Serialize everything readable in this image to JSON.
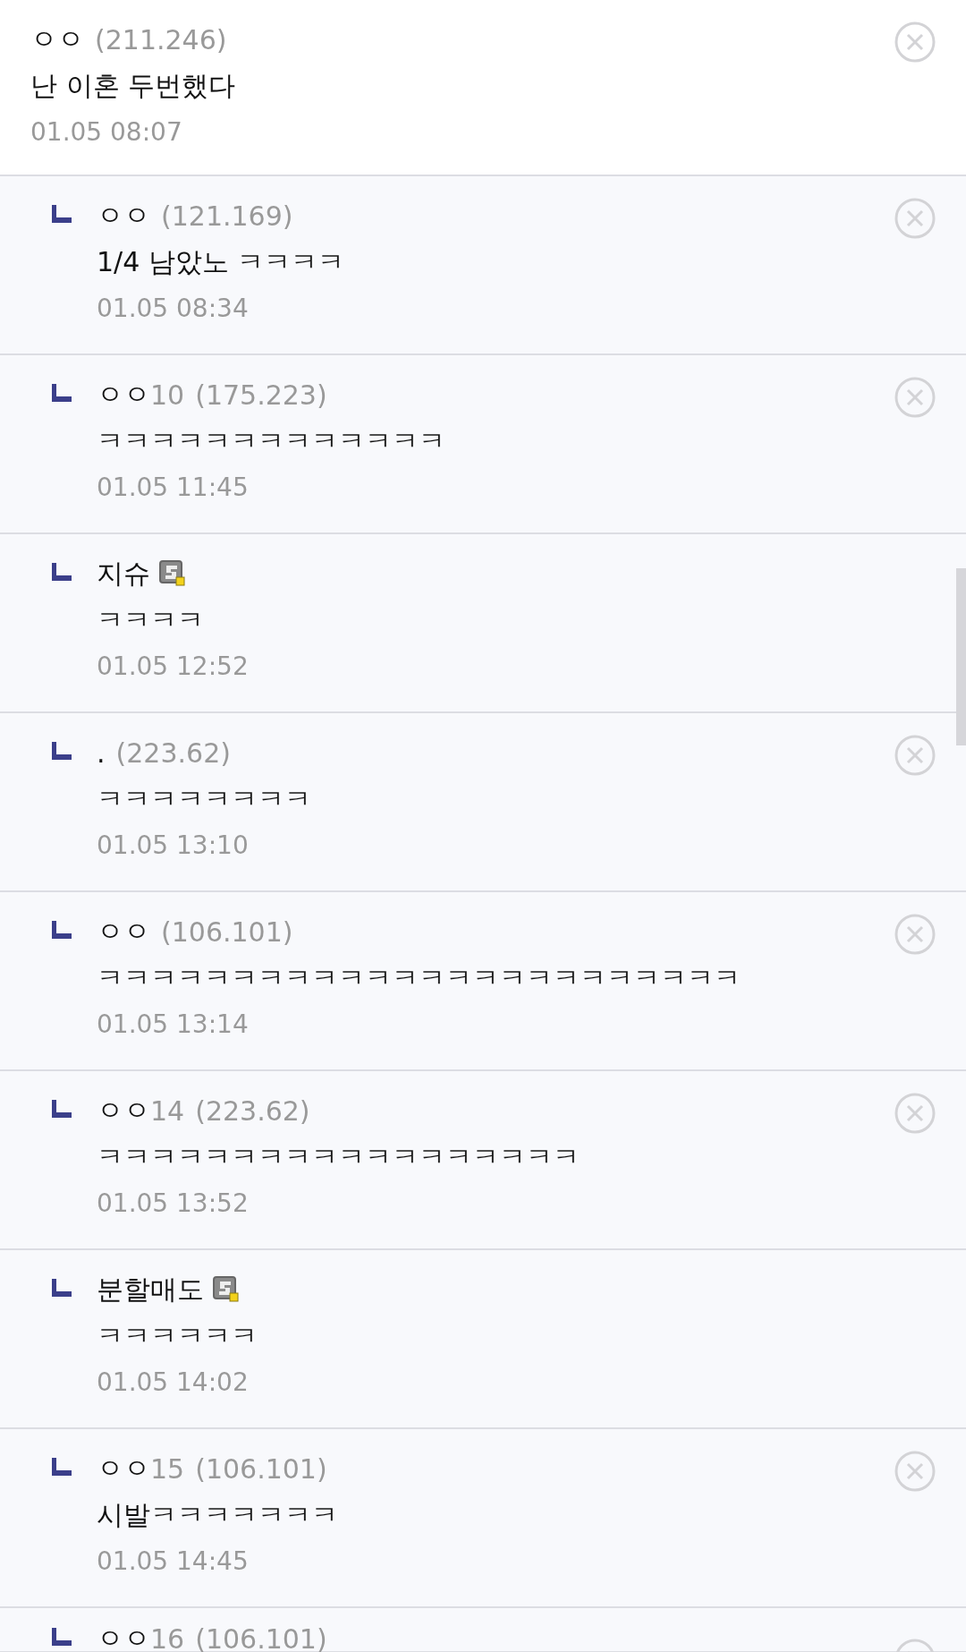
{
  "comments": [
    {
      "kind": "comment",
      "name": "ㅇㅇ",
      "ip": "(211.246)",
      "member": false,
      "deletable": true,
      "text": "난 이혼 두번했다",
      "time": "01.05 08:07"
    },
    {
      "kind": "reply",
      "name": "ㅇㅇ",
      "ip": "(121.169)",
      "member": false,
      "deletable": true,
      "text": "1/4 남았노 ㅋㅋㅋㅋ",
      "time": "01.05 08:34"
    },
    {
      "kind": "reply",
      "name": "ㅇㅇ",
      "tag": "10",
      "ip": "(175.223)",
      "member": false,
      "deletable": true,
      "text": "ㅋㅋㅋㅋㅋㅋㅋㅋㅋㅋㅋㅋㅋ",
      "time": "01.05 11:45"
    },
    {
      "kind": "reply",
      "name": "지슈",
      "member": true,
      "deletable": false,
      "text": "ㅋㅋㅋㅋ",
      "time": "01.05 12:52"
    },
    {
      "kind": "reply",
      "name": ".",
      "ip": "(223.62)",
      "member": false,
      "deletable": true,
      "text": "ㅋㅋㅋㅋㅋㅋㅋㅋ",
      "time": "01.05 13:10"
    },
    {
      "kind": "reply",
      "name": "ㅇㅇ",
      "ip": "(106.101)",
      "member": false,
      "deletable": true,
      "text": "ㅋㅋㅋㅋㅋㅋㅋㅋㅋㅋㅋㅋㅋㅋㅋㅋㅋㅋㅋㅋㅋㅋㅋㅋ",
      "time": "01.05 13:14"
    },
    {
      "kind": "reply",
      "name": "ㅇㅇ",
      "tag": "14",
      "ip": "(223.62)",
      "member": false,
      "deletable": true,
      "text": "ㅋㅋㅋㅋㅋㅋㅋㅋㅋㅋㅋㅋㅋㅋㅋㅋㅋㅋ",
      "time": "01.05 13:52"
    },
    {
      "kind": "reply",
      "name": "분할매도",
      "member": true,
      "deletable": false,
      "text": "ㅋㅋㅋㅋㅋㅋ",
      "time": "01.05 14:02"
    },
    {
      "kind": "reply",
      "name": "ㅇㅇ",
      "tag": "15",
      "ip": "(106.101)",
      "member": false,
      "deletable": true,
      "text": "시발ㅋㅋㅋㅋㅋㅋㅋ",
      "time": "01.05 14:45"
    },
    {
      "kind": "reply_partial",
      "name": "ㅇㅇ",
      "tag": "16",
      "ip": "(106.101)",
      "member": false,
      "deletable": true
    }
  ]
}
